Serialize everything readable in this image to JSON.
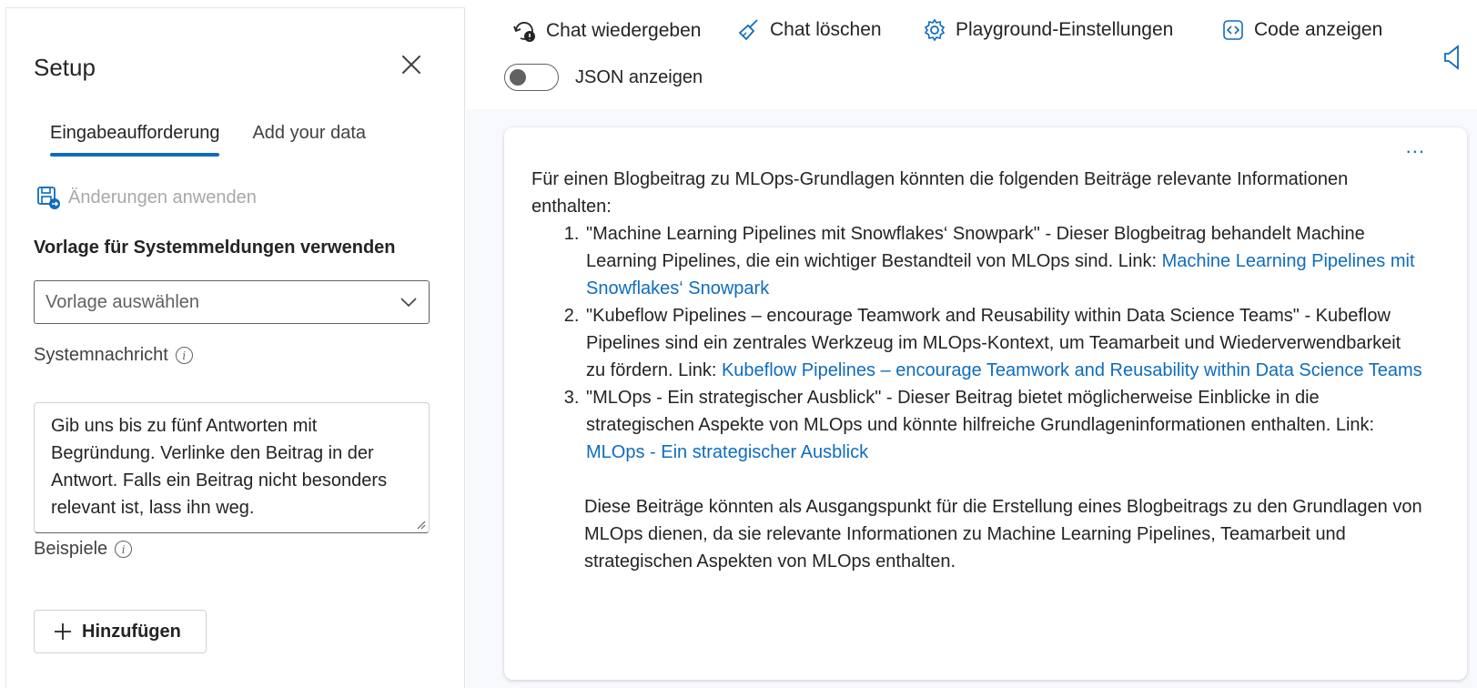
{
  "setup": {
    "title": "Setup",
    "tabs": [
      {
        "label": "Eingabeaufforderung",
        "active": true
      },
      {
        "label": "Add your data",
        "active": false
      }
    ],
    "apply_changes_label": "Änderungen anwenden",
    "template_section_label": "Vorlage für Systemmeldungen verwenden",
    "template_select": {
      "value": "Vorlage auswählen"
    },
    "system_message_label": "Systemnachricht",
    "system_message_value": "Gib uns bis zu fünf Antworten mit Begründung. Verlinke den Beitrag in der Antwort. Falls ein Beitrag nicht besonders relevant ist, lass ihn weg.",
    "examples_label": "Beispiele",
    "add_button_label": "Hinzufügen"
  },
  "toolbar": {
    "replay_chat": "Chat wiedergeben",
    "clear_chat": "Chat löschen",
    "playground_settings": "Playground-Einstellungen",
    "view_code": "Code anzeigen",
    "show_json": "JSON anzeigen",
    "show_json_on": false
  },
  "chat": {
    "more": "...",
    "intro": "Für einen Blogbeitrag zu MLOps-Grundlagen könnten die folgenden Beiträge relevante Informationen enthalten:",
    "items": [
      {
        "text": "\"Machine Learning Pipelines mit Snowflakes‘ Snowpark\" - Dieser Blogbeitrag behandelt Machine Learning Pipelines, die ein wichtiger Bestandteil von MLOps sind. Link: ",
        "link": "Machine Learning Pipelines mit Snowflakes‘ Snowpark"
      },
      {
        "text": "\"Kubeflow Pipelines – encourage Teamwork and Reusability within Data Science Teams\" - Kubeflow Pipelines sind ein zentrales Werkzeug im MLOps-Kontext, um Teamarbeit und Wiederverwendbarkeit zu fördern. Link: ",
        "link": "Kubeflow Pipelines – encourage Teamwork and Reusability within Data Science Teams"
      },
      {
        "text": "\"MLOps - Ein strategischer Ausblick\" - Dieser Beitrag bietet möglicherweise Einblicke in die strategischen Aspekte von MLOps und könnte hilfreiche Grundlageninformationen enthalten. Link: ",
        "link": "MLOps - Ein strategischer Ausblick"
      }
    ],
    "closing": "Diese Beiträge könnten als Ausgangspunkt für die Erstellung eines Blogbeitrags zu den Grundlagen von MLOps dienen, da sie relevante Informationen zu Machine Learning Pipelines, Teamarbeit und strategischen Aspekten von MLOps enthalten."
  },
  "colors": {
    "accent": "#0f6cbd",
    "disabled_text": "#a8a8a8"
  },
  "icons": {
    "close": "close-icon",
    "apply": "save-apply-icon",
    "dropdown": "chevron-down-icon",
    "info": "info-icon",
    "add": "plus-icon",
    "replay": "replay-chat-icon",
    "clear": "broom-icon",
    "settings": "gear-icon",
    "code": "code-icon",
    "speaker": "speaker-icon"
  }
}
